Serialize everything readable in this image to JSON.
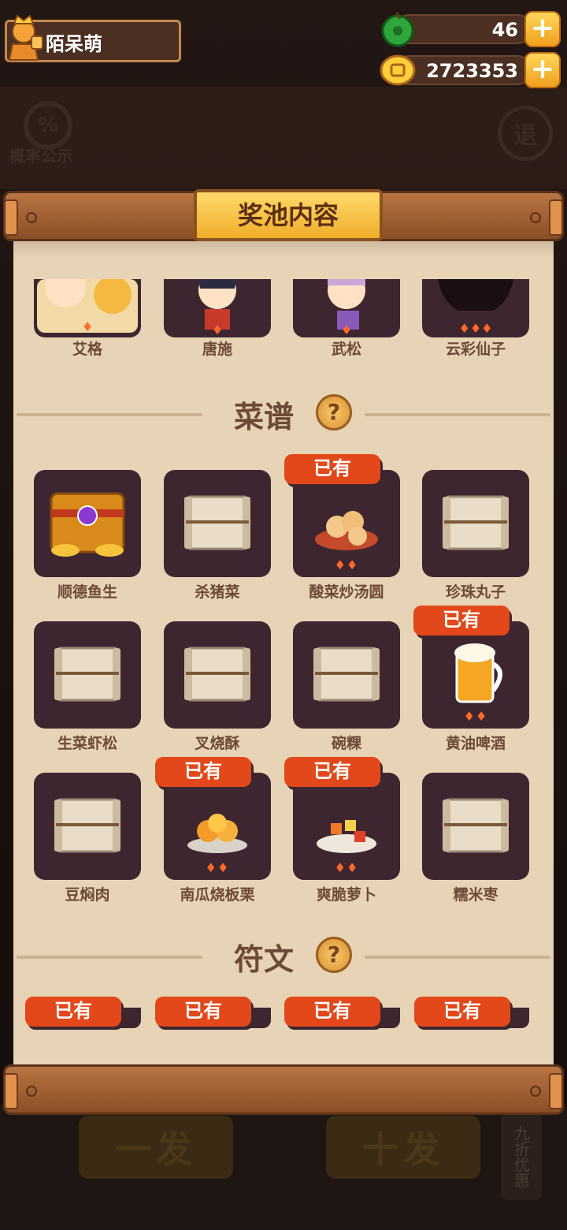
{
  "player": {
    "name": "陌呆萌"
  },
  "resources": {
    "jade": "46",
    "gold": "2723353"
  },
  "background": {
    "probability_label": "概率公示",
    "probability_icon": "%",
    "exit_label": "退",
    "single_draw": "一发",
    "ten_draw": "十发",
    "discount": "九折优惠"
  },
  "panel": {
    "title": "奖池内容",
    "characters": [
      "艾格",
      "唐施",
      "武松",
      "云彩仙子"
    ],
    "recipes": {
      "title": "菜谱",
      "items": [
        {
          "label": "顺德鱼生",
          "owned": false
        },
        {
          "label": "杀猪菜",
          "owned": false
        },
        {
          "label": "酸菜炒汤圆",
          "owned": true
        },
        {
          "label": "珍珠丸子",
          "owned": false
        },
        {
          "label": "生菜虾松",
          "owned": false
        },
        {
          "label": "叉烧酥",
          "owned": false
        },
        {
          "label": "碗粿",
          "owned": false
        },
        {
          "label": "黄油啤酒",
          "owned": true
        },
        {
          "label": "豆焖肉",
          "owned": false
        },
        {
          "label": "南瓜烧板栗",
          "owned": true
        },
        {
          "label": "爽脆萝卜",
          "owned": true
        },
        {
          "label": "糯米枣",
          "owned": false
        }
      ]
    },
    "runes": {
      "title": "符文",
      "owned_labels": [
        "已有",
        "已有",
        "已有",
        "已有"
      ]
    },
    "owned_label": "已有",
    "help_glyph": "?"
  },
  "colors": {
    "owned_tag": "#e2481a",
    "card_bg": "#3e2631",
    "paper": "#e7d3b5",
    "text_brown": "#6b4a36"
  }
}
